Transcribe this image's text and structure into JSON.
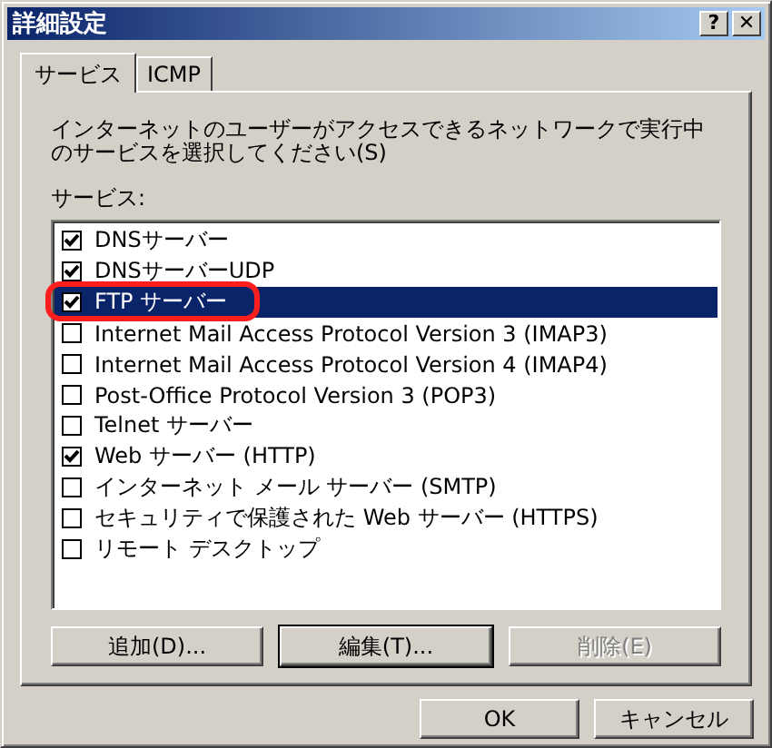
{
  "window": {
    "title": "詳細設定",
    "help_button": "?",
    "close_button": "✕"
  },
  "tabs": [
    {
      "label": "サービス",
      "selected": true
    },
    {
      "label": "ICMP",
      "selected": false
    }
  ],
  "description": "インターネットのユーザーがアクセスできるネットワークで実行中のサービスを選択してください(S)",
  "services_label": "サービス:",
  "services": [
    {
      "label": "DNSサーバー",
      "checked": true,
      "selected": false,
      "circled": false
    },
    {
      "label": "DNSサーバーUDP",
      "checked": true,
      "selected": false,
      "circled": false
    },
    {
      "label": "FTP サーバー",
      "checked": true,
      "selected": true,
      "circled": true
    },
    {
      "label": "Internet Mail Access Protocol Version 3 (IMAP3)",
      "checked": false,
      "selected": false,
      "circled": false
    },
    {
      "label": "Internet Mail Access Protocol Version 4 (IMAP4)",
      "checked": false,
      "selected": false,
      "circled": false
    },
    {
      "label": "Post-Office Protocol Version 3 (POP3)",
      "checked": false,
      "selected": false,
      "circled": false
    },
    {
      "label": "Telnet サーバー",
      "checked": false,
      "selected": false,
      "circled": false
    },
    {
      "label": "Web サーバー (HTTP)",
      "checked": true,
      "selected": false,
      "circled": false
    },
    {
      "label": "インターネット メール サーバー (SMTP)",
      "checked": false,
      "selected": false,
      "circled": false
    },
    {
      "label": "セキュリティで保護された Web サーバー (HTTPS)",
      "checked": false,
      "selected": false,
      "circled": false
    },
    {
      "label": "リモート デスクトップ",
      "checked": false,
      "selected": false,
      "circled": false
    }
  ],
  "list_buttons": [
    {
      "label": "追加(D)...",
      "disabled": false,
      "focused": false
    },
    {
      "label": "編集(T)...",
      "disabled": false,
      "focused": true
    },
    {
      "label": "削除(E)",
      "disabled": true,
      "focused": false
    }
  ],
  "dialog_buttons": [
    {
      "label": "OK"
    },
    {
      "label": "キャンセル"
    }
  ]
}
